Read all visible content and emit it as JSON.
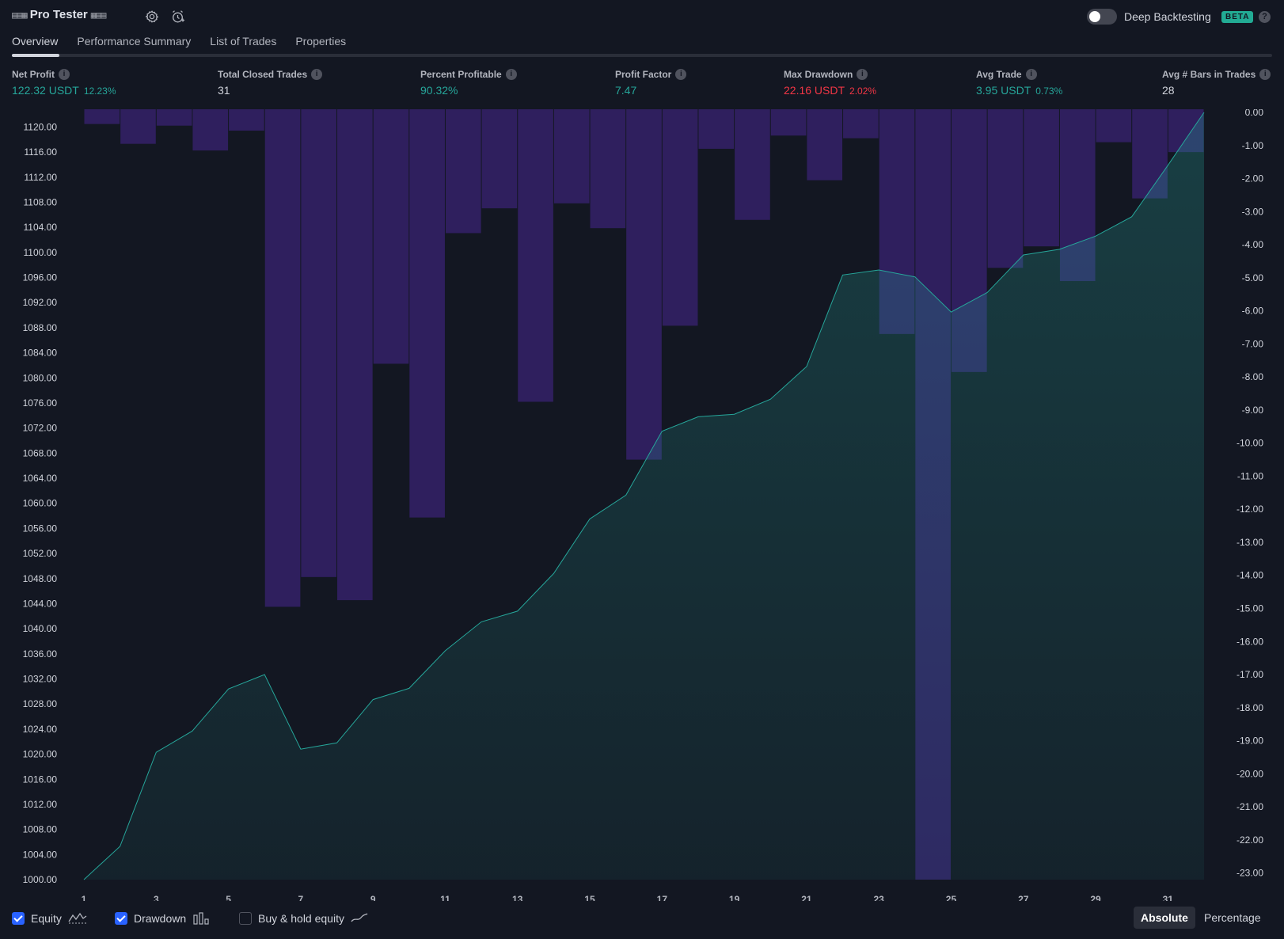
{
  "header": {
    "title": "Pro Tester",
    "title_glyphs_left": "▤▤▦",
    "title_glyphs_right": "▦▤▤",
    "deep_backtesting_label": "Deep Backtesting",
    "deep_backtesting_enabled": false,
    "beta_badge": "BETA",
    "help_label": "?"
  },
  "tabs": [
    {
      "label": "Overview",
      "active": true
    },
    {
      "label": "Performance Summary",
      "active": false
    },
    {
      "label": "List of Trades",
      "active": false
    },
    {
      "label": "Properties",
      "active": false
    }
  ],
  "stats": [
    {
      "label": "Net Profit",
      "value": "122.32 USDT",
      "sub": "12.23%",
      "color": "#26a69a"
    },
    {
      "label": "Total Closed Trades",
      "value": "31",
      "sub": "",
      "color": "#d1d4dc"
    },
    {
      "label": "Percent Profitable",
      "value": "90.32%",
      "sub": "",
      "color": "#26a69a"
    },
    {
      "label": "Profit Factor",
      "value": "7.47",
      "sub": "",
      "color": "#26a69a"
    },
    {
      "label": "Max Drawdown",
      "value": "22.16 USDT",
      "sub": "2.02%",
      "color": "#f23645"
    },
    {
      "label": "Avg Trade",
      "value": "3.95 USDT",
      "sub": "0.73%",
      "color": "#26a69a"
    },
    {
      "label": "Avg # Bars in Trades",
      "value": "28",
      "sub": "",
      "color": "#d1d4dc"
    }
  ],
  "chart_data": {
    "type": "area",
    "x": [
      1,
      2,
      3,
      4,
      5,
      6,
      7,
      8,
      9,
      10,
      11,
      12,
      13,
      14,
      15,
      16,
      17,
      18,
      19,
      20,
      21,
      22,
      23,
      24,
      25,
      26,
      27,
      28,
      29,
      30,
      31,
      32
    ],
    "x_tick_labels": [
      "1",
      "3",
      "5",
      "7",
      "9",
      "11",
      "13",
      "15",
      "17",
      "19",
      "21",
      "23",
      "25",
      "27",
      "29",
      "31"
    ],
    "left_axis": {
      "ylim": [
        1000,
        1122.32
      ],
      "tick_labels": [
        "1120.00",
        "1116.00",
        "1112.00",
        "1108.00",
        "1104.00",
        "1100.00",
        "1096.00",
        "1092.00",
        "1088.00",
        "1084.00",
        "1080.00",
        "1076.00",
        "1072.00",
        "1068.00",
        "1064.00",
        "1060.00",
        "1056.00",
        "1052.00",
        "1048.00",
        "1044.00",
        "1040.00",
        "1036.00",
        "1032.00",
        "1028.00",
        "1024.00",
        "1020.00",
        "1016.00",
        "1012.00",
        "1008.00",
        "1004.00",
        "1000.00"
      ]
    },
    "right_axis": {
      "ylim": [
        -23.2,
        0
      ],
      "tick_labels": [
        "0.00",
        "-1.00",
        "-2.00",
        "-3.00",
        "-4.00",
        "-5.00",
        "-6.00",
        "-7.00",
        "-8.00",
        "-9.00",
        "-10.00",
        "-11.00",
        "-12.00",
        "-13.00",
        "-14.00",
        "-15.00",
        "-16.00",
        "-17.00",
        "-18.00",
        "-19.00",
        "-20.00",
        "-21.00",
        "-22.00",
        "-23.00"
      ]
    },
    "series": [
      {
        "name": "Equity",
        "color": "#26a69a",
        "values": [
          1000,
          1005.3,
          1020.3,
          1023.7,
          1030.4,
          1032.7,
          1020.8,
          1021.8,
          1028.7,
          1030.5,
          1036.5,
          1041.1,
          1042.8,
          1048.8,
          1057.5,
          1061.3,
          1071.5,
          1073.8,
          1074.2,
          1076.6,
          1081.8,
          1096.4,
          1097.2,
          1096.1,
          1090.5,
          1093.6,
          1099.6,
          1100.5,
          1102.6,
          1105.7,
          1113.9,
          1122.32
        ]
      },
      {
        "name": "Drawdown",
        "color": "#2f1f5e",
        "bar_values": [
          -0.35,
          -0.95,
          -0.4,
          -1.15,
          -0.55,
          -14.95,
          -14.05,
          -14.75,
          -7.6,
          -12.25,
          -3.65,
          -2.9,
          -8.75,
          -2.75,
          -3.5,
          -10.5,
          -6.45,
          -1.1,
          -3.25,
          -0.7,
          -2.05,
          -0.78,
          -6.7,
          -23.2,
          -7.85,
          -4.7,
          -4.05,
          -5.1,
          -0.9,
          -2.6,
          -1.2
        ]
      }
    ]
  },
  "legend": {
    "items": [
      {
        "label": "Equity",
        "checked": true,
        "icon": "equity-line-icon"
      },
      {
        "label": "Drawdown",
        "checked": true,
        "icon": "drawdown-bars-icon"
      },
      {
        "label": "Buy & hold equity",
        "checked": false,
        "icon": "buyhold-line-icon"
      }
    ],
    "modes": [
      "Absolute",
      "Percentage"
    ],
    "active_mode": "Absolute"
  }
}
